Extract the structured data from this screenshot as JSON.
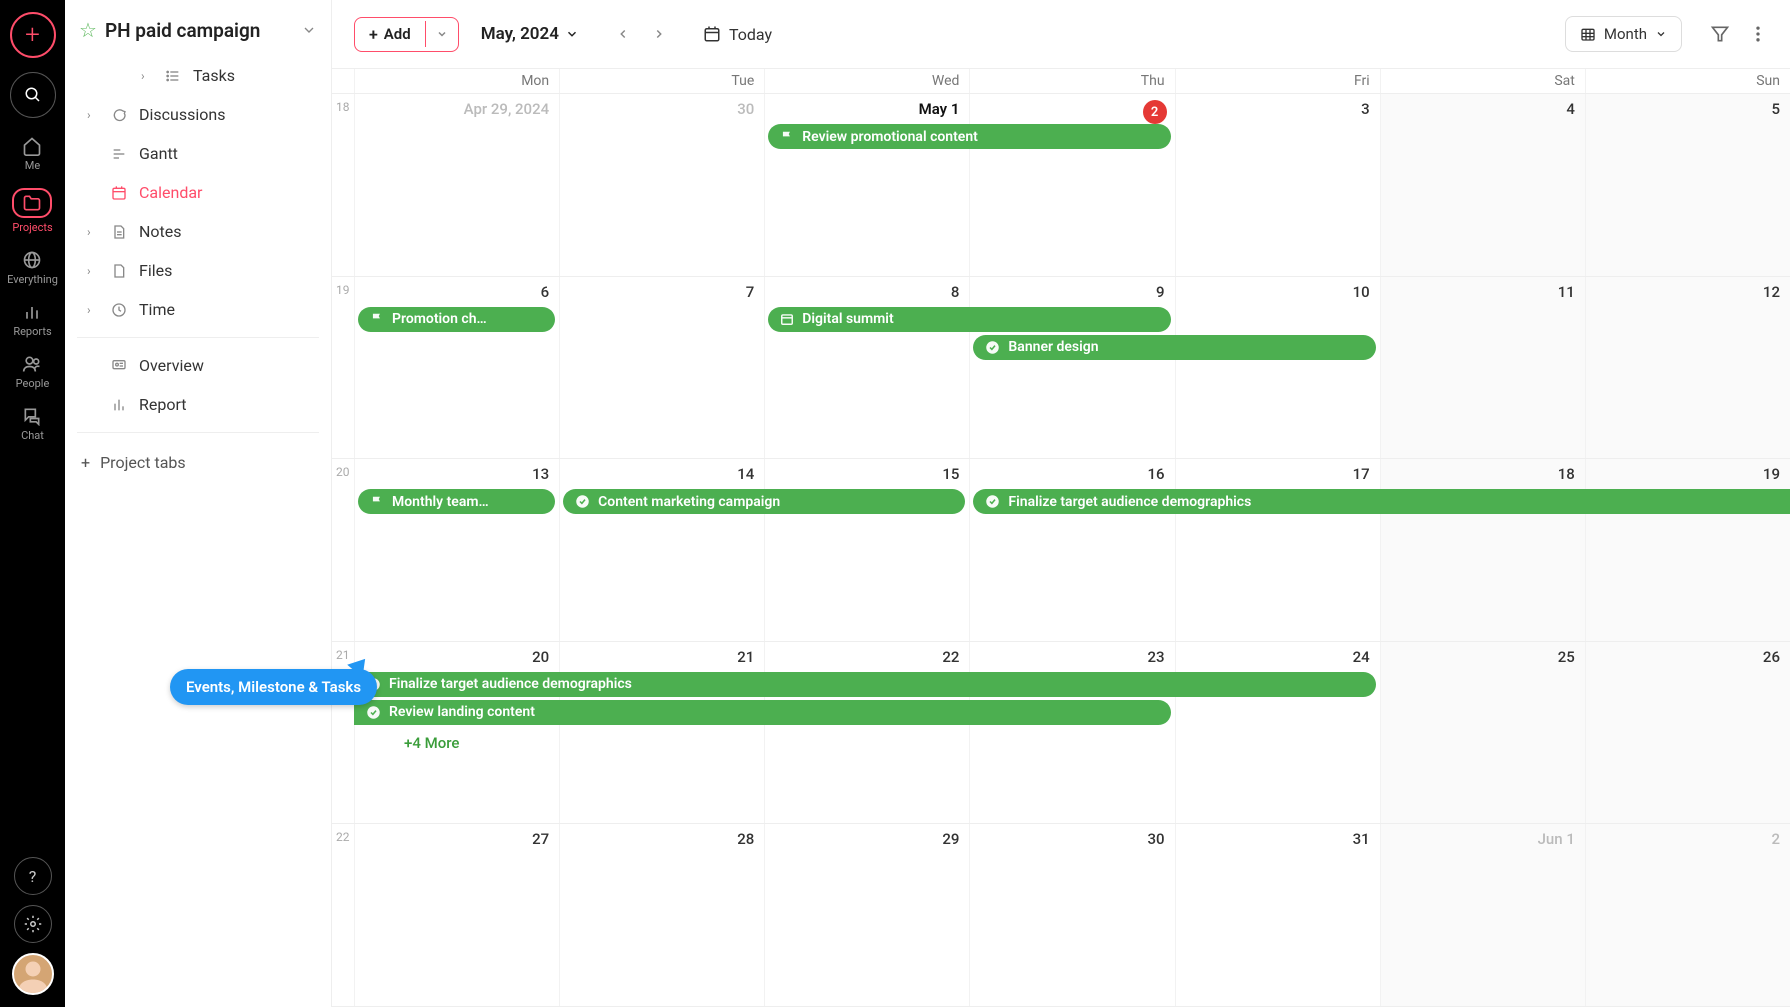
{
  "rail": {
    "items": [
      {
        "key": "me",
        "label": "Me",
        "icon": "home"
      },
      {
        "key": "projects",
        "label": "Projects",
        "icon": "folder",
        "active": true
      },
      {
        "key": "everything",
        "label": "Everything",
        "icon": "globe"
      },
      {
        "key": "reports",
        "label": "Reports",
        "icon": "bar"
      },
      {
        "key": "people",
        "label": "People",
        "icon": "people"
      },
      {
        "key": "chat",
        "label": "Chat",
        "icon": "chat"
      }
    ]
  },
  "sidebar": {
    "title": "PH paid campaign",
    "items": [
      {
        "label": "Tasks",
        "icon": "tasks",
        "indent": true,
        "caret": true
      },
      {
        "label": "Discussions",
        "icon": "discuss",
        "caret": true
      },
      {
        "label": "Gantt",
        "icon": "gantt"
      },
      {
        "label": "Calendar",
        "icon": "calendar",
        "selected": true
      },
      {
        "label": "Notes",
        "icon": "notes",
        "caret": true
      },
      {
        "label": "Files",
        "icon": "files",
        "caret": true
      },
      {
        "label": "Time",
        "icon": "time",
        "caret": true
      }
    ],
    "extra": [
      {
        "label": "Overview",
        "icon": "overview"
      },
      {
        "label": "Report",
        "icon": "report"
      }
    ],
    "project_tabs": "Project tabs"
  },
  "toolbar": {
    "add": "Add",
    "month": "May, 2024",
    "today": "Today",
    "view": "Month"
  },
  "calendar": {
    "day_headers": [
      "Mon",
      "Tue",
      "Wed",
      "Thu",
      "Fri",
      "Sat",
      "Sun"
    ],
    "weeks": [
      {
        "num": "18",
        "days": [
          {
            "label": "Apr 29, 2024",
            "dim": true
          },
          {
            "label": "30",
            "dim": true
          },
          {
            "label": "May 1",
            "month": true
          },
          {
            "label": "",
            "badge": "2"
          },
          {
            "label": "3"
          },
          {
            "label": "4",
            "wknd": true
          },
          {
            "label": "5",
            "wknd": true
          }
        ],
        "events": [
          {
            "label": "Review promotional content",
            "icon": "flag",
            "start": 2,
            "span": 2,
            "row": 0
          }
        ]
      },
      {
        "num": "19",
        "days": [
          {
            "label": "6"
          },
          {
            "label": "7"
          },
          {
            "label": "8"
          },
          {
            "label": "9"
          },
          {
            "label": "10"
          },
          {
            "label": "11",
            "wknd": true
          },
          {
            "label": "12",
            "wknd": true
          }
        ],
        "events": [
          {
            "label": "Promotion ch…",
            "icon": "flag",
            "start": 0,
            "span": 1,
            "row": 0
          },
          {
            "label": "Digital summit",
            "icon": "cal",
            "start": 2,
            "span": 2,
            "row": 0
          },
          {
            "label": "Banner design",
            "icon": "check",
            "start": 3,
            "span": 2,
            "row": 1
          }
        ]
      },
      {
        "num": "20",
        "days": [
          {
            "label": "13"
          },
          {
            "label": "14"
          },
          {
            "label": "15"
          },
          {
            "label": "16"
          },
          {
            "label": "17"
          },
          {
            "label": "18",
            "wknd": true
          },
          {
            "label": "19",
            "wknd": true
          }
        ],
        "events": [
          {
            "label": "Monthly team…",
            "icon": "flag",
            "start": 0,
            "span": 1,
            "row": 0
          },
          {
            "label": "Content marketing campaign",
            "icon": "check",
            "start": 1,
            "span": 2,
            "row": 0
          },
          {
            "label": "Finalize target audience demographics",
            "icon": "check",
            "start": 3,
            "span": 4,
            "row": 0,
            "openright": true
          }
        ]
      },
      {
        "num": "21",
        "days": [
          {
            "label": "20"
          },
          {
            "label": "21"
          },
          {
            "label": "22"
          },
          {
            "label": "23"
          },
          {
            "label": "24"
          },
          {
            "label": "25",
            "wknd": true
          },
          {
            "label": "26",
            "wknd": true
          }
        ],
        "events": [
          {
            "label": "Finalize target audience demographics",
            "icon": "check",
            "start": 0,
            "span": 5,
            "row": 0,
            "openleft": true
          },
          {
            "label": "Review landing content",
            "icon": "check",
            "start": 0,
            "span": 4,
            "row": 1,
            "openleft": true
          }
        ],
        "more": {
          "label": "+4 More",
          "col": 0
        }
      },
      {
        "num": "22",
        "days": [
          {
            "label": "27"
          },
          {
            "label": "28"
          },
          {
            "label": "29"
          },
          {
            "label": "30"
          },
          {
            "label": "31"
          },
          {
            "label": "Jun 1",
            "wknd": true,
            "dim": true
          },
          {
            "label": "2",
            "wknd": true,
            "dim": true
          }
        ],
        "events": []
      }
    ]
  },
  "callout": "Events, Milestone & Tasks"
}
